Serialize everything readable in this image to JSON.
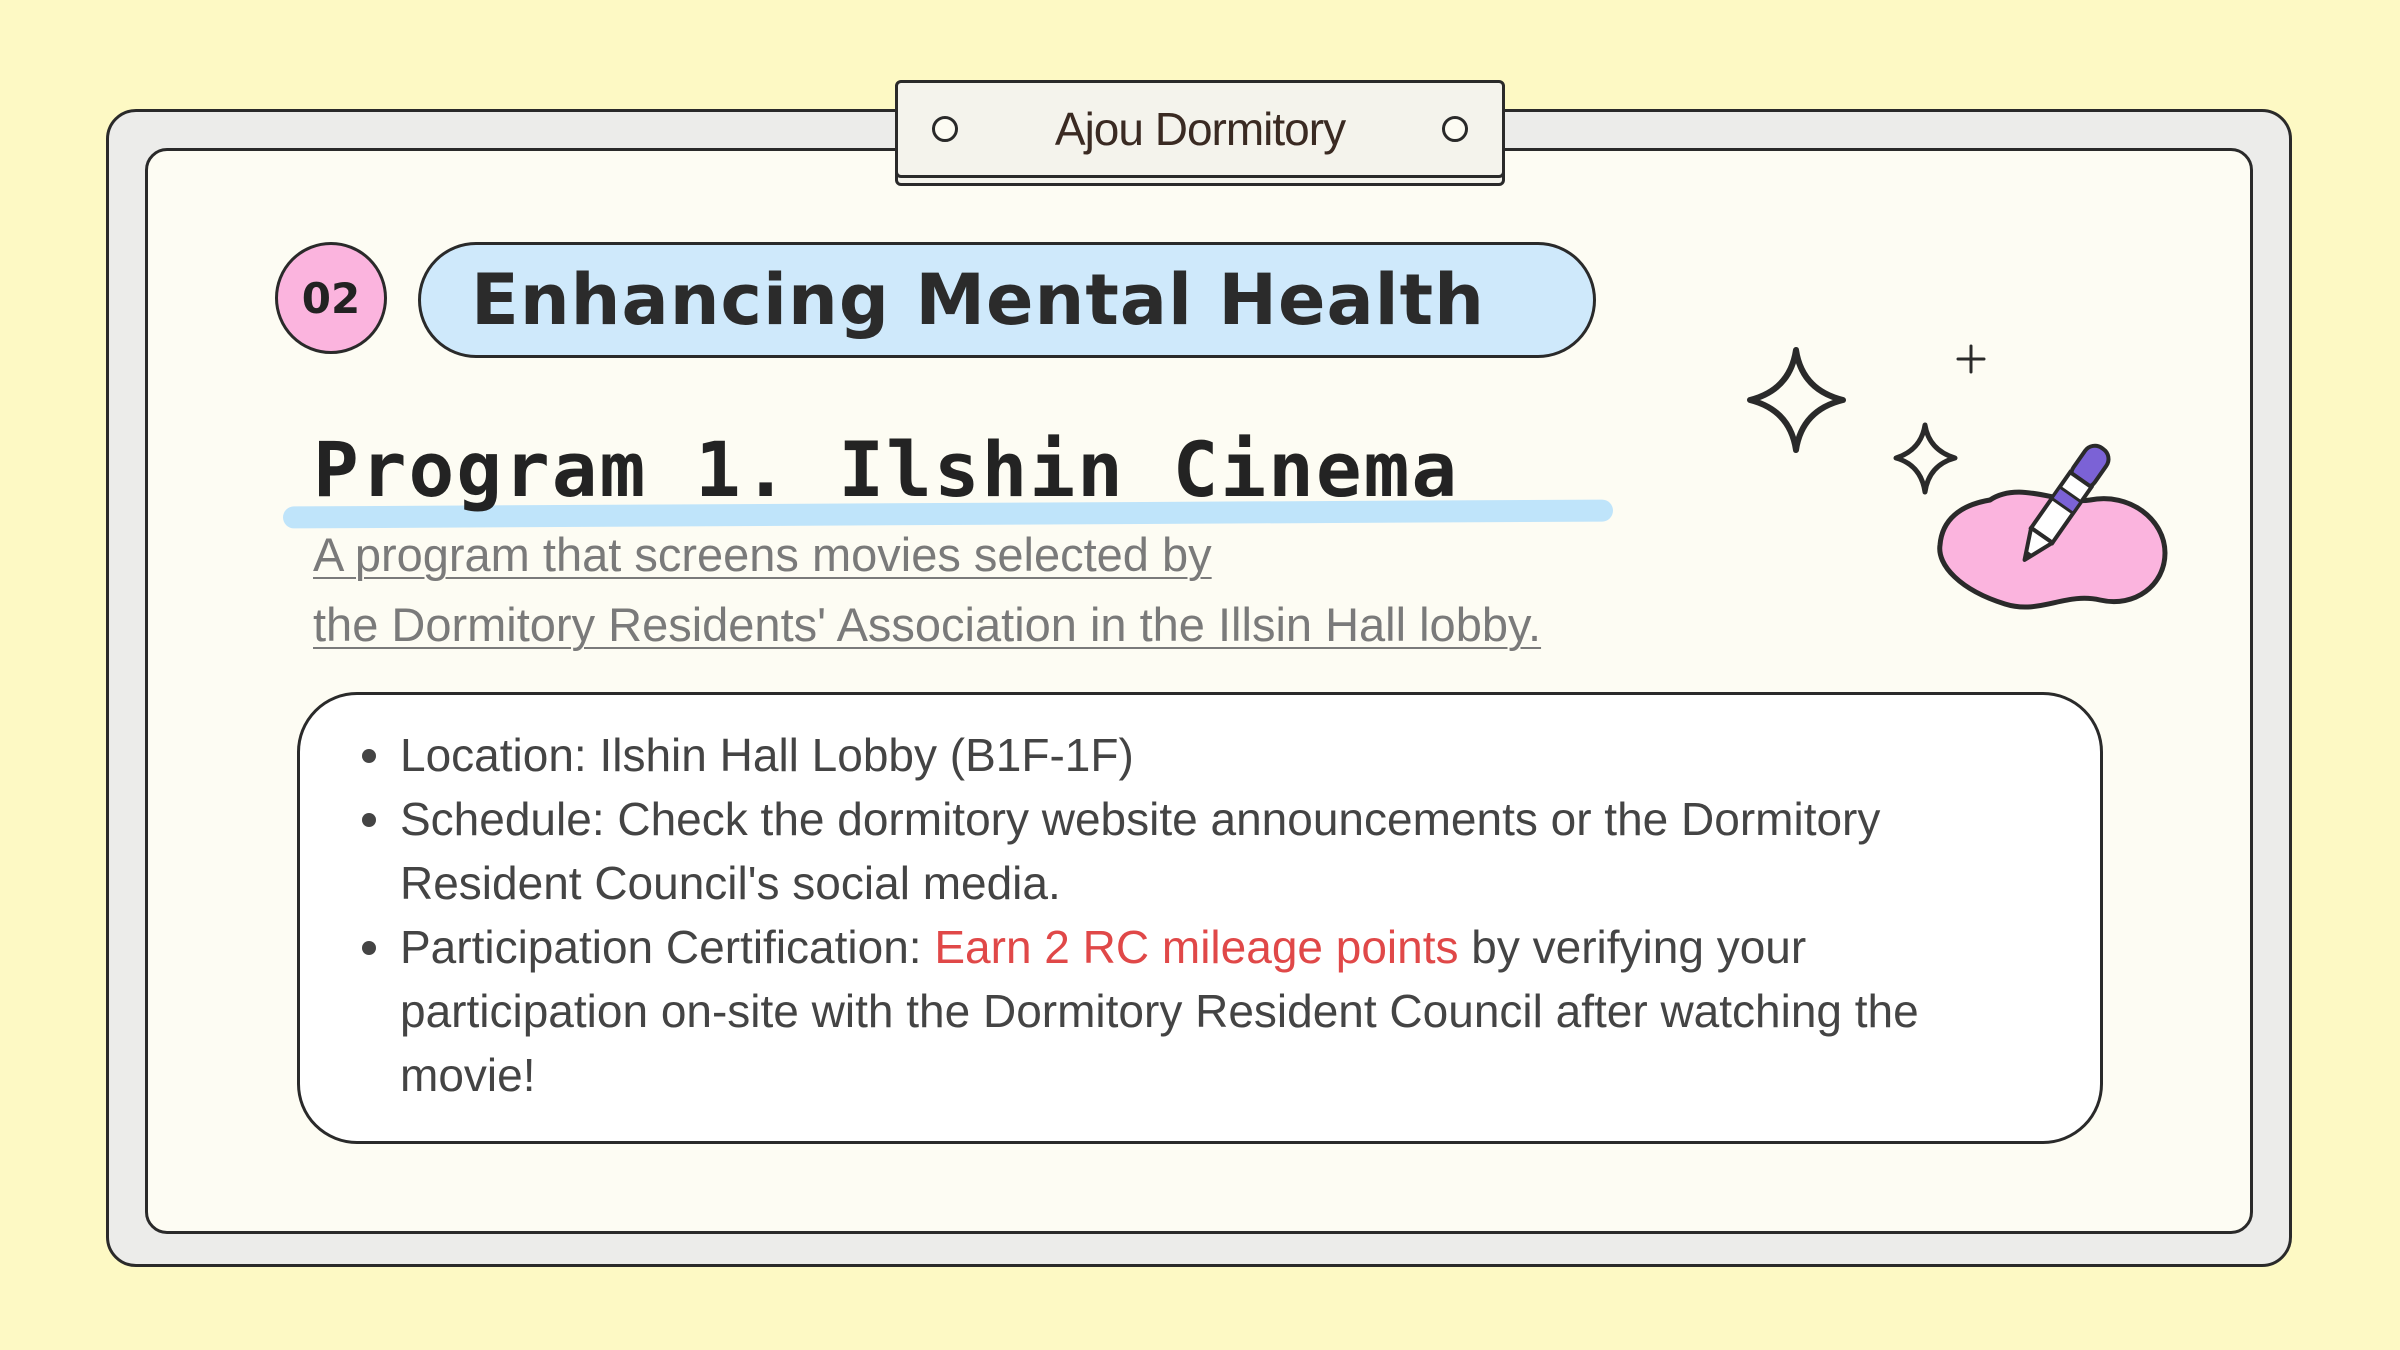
{
  "header": {
    "tab_title": "Ajou Dormitory"
  },
  "section": {
    "number": "02",
    "title": "Enhancing Mental Health"
  },
  "program": {
    "title": "Program 1. Ilshin Cinema",
    "description_lines": [
      "A program that screens movies selected by",
      "the Dormitory Residents' Association in the Illsin Hall lobby."
    ]
  },
  "details": [
    {
      "text": " Location: Ilshin Hall Lobby (B1F-1F)"
    },
    {
      "text": "Schedule: Check the dormitory website announcements or the Dormitory  Resident Council's social media."
    },
    {
      "prefix": "Participation Certification: ",
      "highlight": "Earn 2 RC mileage points",
      "suffix": " by verifying your participation on-site with the Dormitory  Resident Council after watching the movie!"
    }
  ],
  "colors": {
    "background": "#fdf9c4",
    "badge_pink": "#fbb4de",
    "pill_blue": "#cfe9fb",
    "highlight_red": "#e04848",
    "pen_purple": "#7b62d6"
  },
  "decorations": {
    "icons": [
      "sparkle-large-icon",
      "sparkle-small-icon",
      "sparkle-tiny-icon",
      "pink-blob-icon",
      "pen-icon"
    ]
  }
}
